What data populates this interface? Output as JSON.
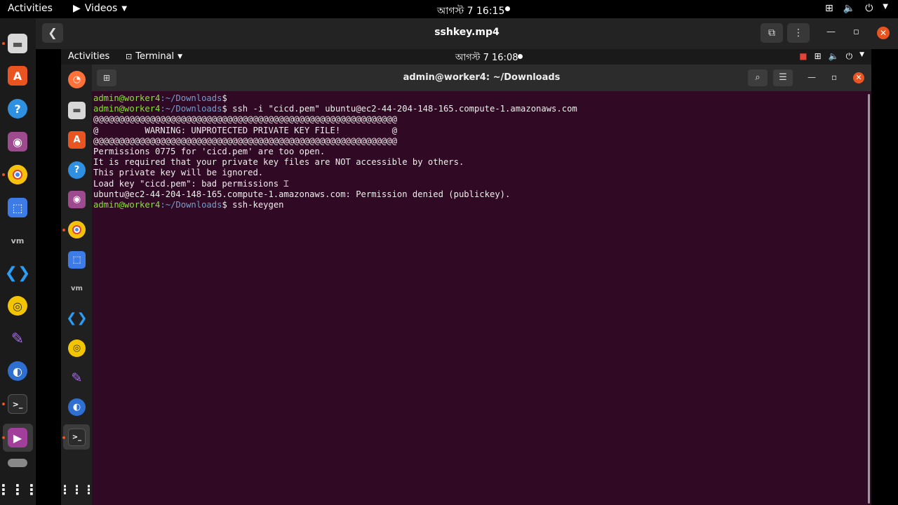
{
  "outer_topbar": {
    "activities": "Activities",
    "app_name": "Videos",
    "clock": "আগস্ট 7  16:15"
  },
  "video_player": {
    "title": "sshkey.mp4"
  },
  "inner_topbar": {
    "activities": "Activities",
    "app_name": "Terminal",
    "clock": "আগস্ট 7  16:08"
  },
  "terminal": {
    "title": "admin@worker4: ~/Downloads",
    "prompt_user": "admin@worker4",
    "prompt_path": ":~/Downloads",
    "prompt_sign": "$",
    "lines": [
      {
        "type": "prompt",
        "cmd": ""
      },
      {
        "type": "prompt",
        "cmd": " ssh -i \"cicd.pem\" ubuntu@ec2-44-204-148-165.compute-1.amazonaws.com"
      },
      {
        "type": "out",
        "text": "@@@@@@@@@@@@@@@@@@@@@@@@@@@@@@@@@@@@@@@@@@@@@@@@@@@@@@@@@@@"
      },
      {
        "type": "out",
        "text": "@         WARNING: UNPROTECTED PRIVATE KEY FILE!          @"
      },
      {
        "type": "out",
        "text": "@@@@@@@@@@@@@@@@@@@@@@@@@@@@@@@@@@@@@@@@@@@@@@@@@@@@@@@@@@@"
      },
      {
        "type": "out",
        "text": "Permissions 0775 for 'cicd.pem' are too open."
      },
      {
        "type": "out",
        "text": "It is required that your private key files are NOT accessible by others."
      },
      {
        "type": "out",
        "text": "This private key will be ignored."
      },
      {
        "type": "out",
        "text": "Load key \"cicd.pem\": bad permissions"
      },
      {
        "type": "out",
        "text": "ubuntu@ec2-44-204-148-165.compute-1.amazonaws.com: Permission denied (publickey)."
      },
      {
        "type": "prompt",
        "cmd": " ssh-keygen"
      }
    ]
  },
  "colors": {
    "terminal_bg": "#300a24",
    "prompt_user": "#8ae234",
    "prompt_path": "#729fcf",
    "accent": "#e95420"
  }
}
